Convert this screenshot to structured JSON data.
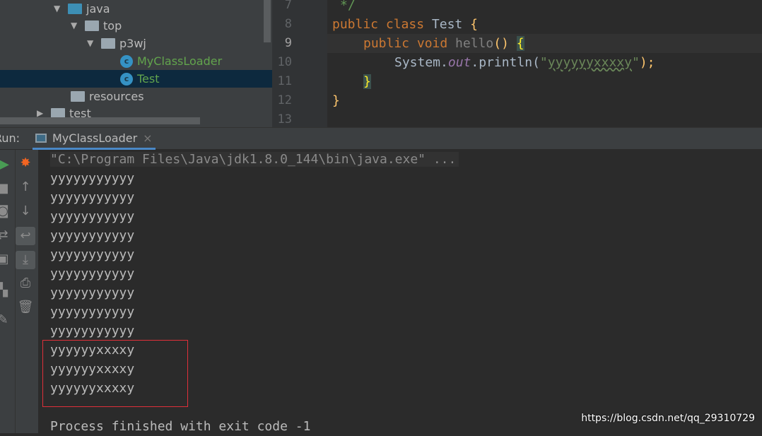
{
  "project_tree": {
    "items": [
      {
        "label": "java",
        "type": "source-folder",
        "expanded": true
      },
      {
        "label": "top",
        "type": "package",
        "expanded": true
      },
      {
        "label": "p3wj",
        "type": "package",
        "expanded": true
      },
      {
        "label": "MyClassLoader",
        "type": "class-runnable"
      },
      {
        "label": "Test",
        "type": "class",
        "selected": true
      },
      {
        "label": "resources",
        "type": "resources-folder"
      },
      {
        "label": "test",
        "type": "folder",
        "expanded": false
      }
    ]
  },
  "editor": {
    "line_numbers": [
      "7",
      "8",
      "9",
      "10",
      "11",
      "12",
      "13"
    ],
    "lines": {
      "l7": "*/",
      "l8": {
        "kw": "public class ",
        "name": "Test ",
        "brace": "{"
      },
      "l9": {
        "kw": "public void ",
        "name": "hello",
        "parens": "()",
        "brace": "{"
      },
      "l10": {
        "a": "System.",
        "field": "out",
        "b": ".println(",
        "q1": "\"",
        "str": "yyyyyyxxxxy",
        "q2": "\"",
        "c": ");"
      },
      "l11": "}",
      "l12": "}"
    }
  },
  "run_panel": {
    "label": "Run:",
    "tab": "MyClassLoader",
    "command": "\"C:\\Program Files\\Java\\jdk1.8.0_144\\bin\\java.exe\" ...",
    "output": [
      "yyyyyyyyyyy",
      "yyyyyyyyyyy",
      "yyyyyyyyyyy",
      "yyyyyyyyyyy",
      "yyyyyyyyyyy",
      "yyyyyyyyyyy",
      "yyyyyyyyyyy",
      "yyyyyyyyyyy",
      "yyyyyyyyyyy",
      "yyyyyyxxxxy",
      "yyyyyyxxxxy",
      "yyyyyyxxxxy"
    ],
    "exit_message": "Process finished with exit code -1"
  },
  "watermark": "https://blog.csdn.net/qq_29310729",
  "colors": {
    "highlight_box": "#e0303a",
    "keyword": "#cc7832",
    "string": "#6a8759"
  }
}
